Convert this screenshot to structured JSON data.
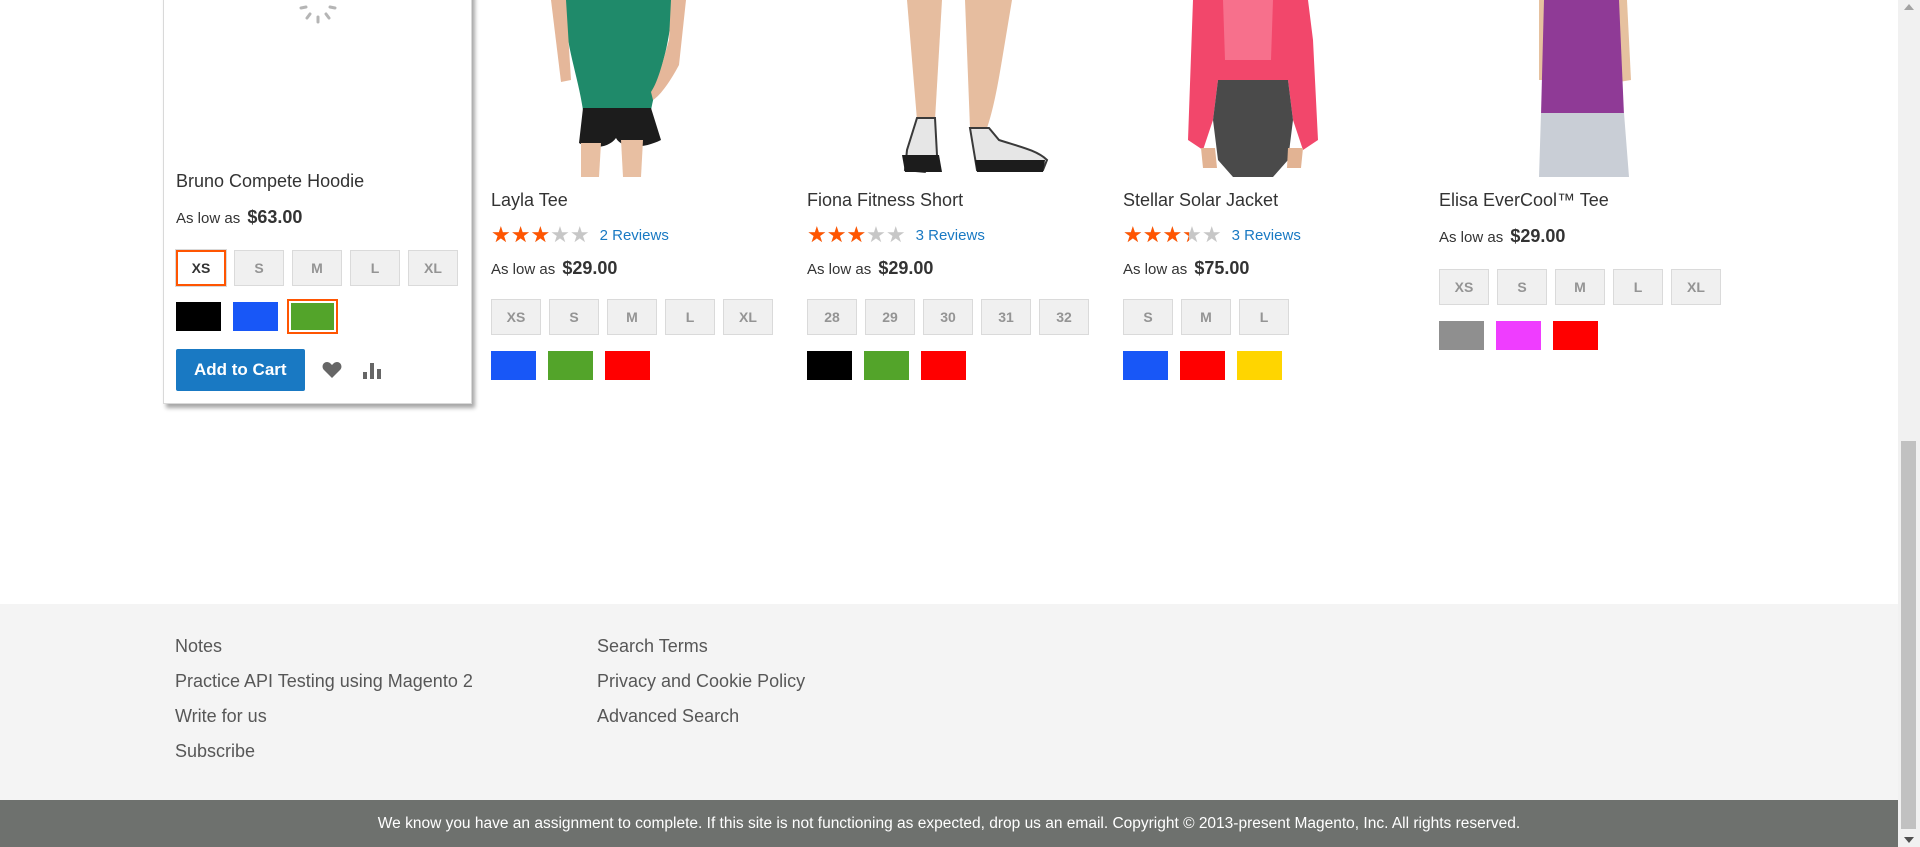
{
  "products": [
    {
      "name": "Bruno Compete Hoodie",
      "price_prefix": "As low as",
      "price": "$63.00",
      "sizes": [
        "XS",
        "S",
        "M",
        "L",
        "XL"
      ],
      "selected_size": "XS",
      "swatch_colors": [
        "#000000",
        "#1857f7",
        "#53a42a"
      ],
      "selected_swatch_index": 2,
      "add_to_cart": "Add to Cart"
    },
    {
      "name": "Layla Tee",
      "rating_percent": 60,
      "reviews": "2 Reviews",
      "price_prefix": "As low as",
      "price": "$29.00",
      "sizes": [
        "XS",
        "S",
        "M",
        "L",
        "XL"
      ],
      "swatch_colors": [
        "#1857f7",
        "#53a42a",
        "#ff0000"
      ]
    },
    {
      "name": "Fiona Fitness Short",
      "rating_percent": 60,
      "reviews": "3 Reviews",
      "price_prefix": "As low as",
      "price": "$29.00",
      "sizes": [
        "28",
        "29",
        "30",
        "31",
        "32"
      ],
      "swatch_colors": [
        "#000000",
        "#53a42a",
        "#ff0000"
      ]
    },
    {
      "name": "Stellar Solar Jacket",
      "rating_percent": 67,
      "reviews": "3 Reviews",
      "price_prefix": "As low as",
      "price": "$75.00",
      "sizes": [
        "S",
        "M",
        "L"
      ],
      "swatch_colors": [
        "#1857f7",
        "#ff0000",
        "#ffd500"
      ]
    },
    {
      "name": "Elisa EverCool™ Tee",
      "price_prefix": "As low as",
      "price": "$29.00",
      "sizes": [
        "XS",
        "S",
        "M",
        "L",
        "XL"
      ],
      "swatch_colors": [
        "#8f8f8f",
        "#ef3dff",
        "#ff0000"
      ]
    }
  ],
  "footer": {
    "col1": [
      "Notes",
      "Practice API Testing using Magento 2",
      "Write for us",
      "Subscribe"
    ],
    "col2": [
      "Search Terms",
      "Privacy and Cookie Policy",
      "Advanced Search"
    ]
  },
  "copyright": "We know you have an assignment to complete. If this site is not functioning as expected, drop us an email. Copyright © 2013-present Magento, Inc. All rights reserved.",
  "colors": {
    "accent": "#1979c3",
    "star": "#ff5501",
    "footer_bg": "#f4f4f4",
    "copyright_bg": "#6e716e"
  }
}
